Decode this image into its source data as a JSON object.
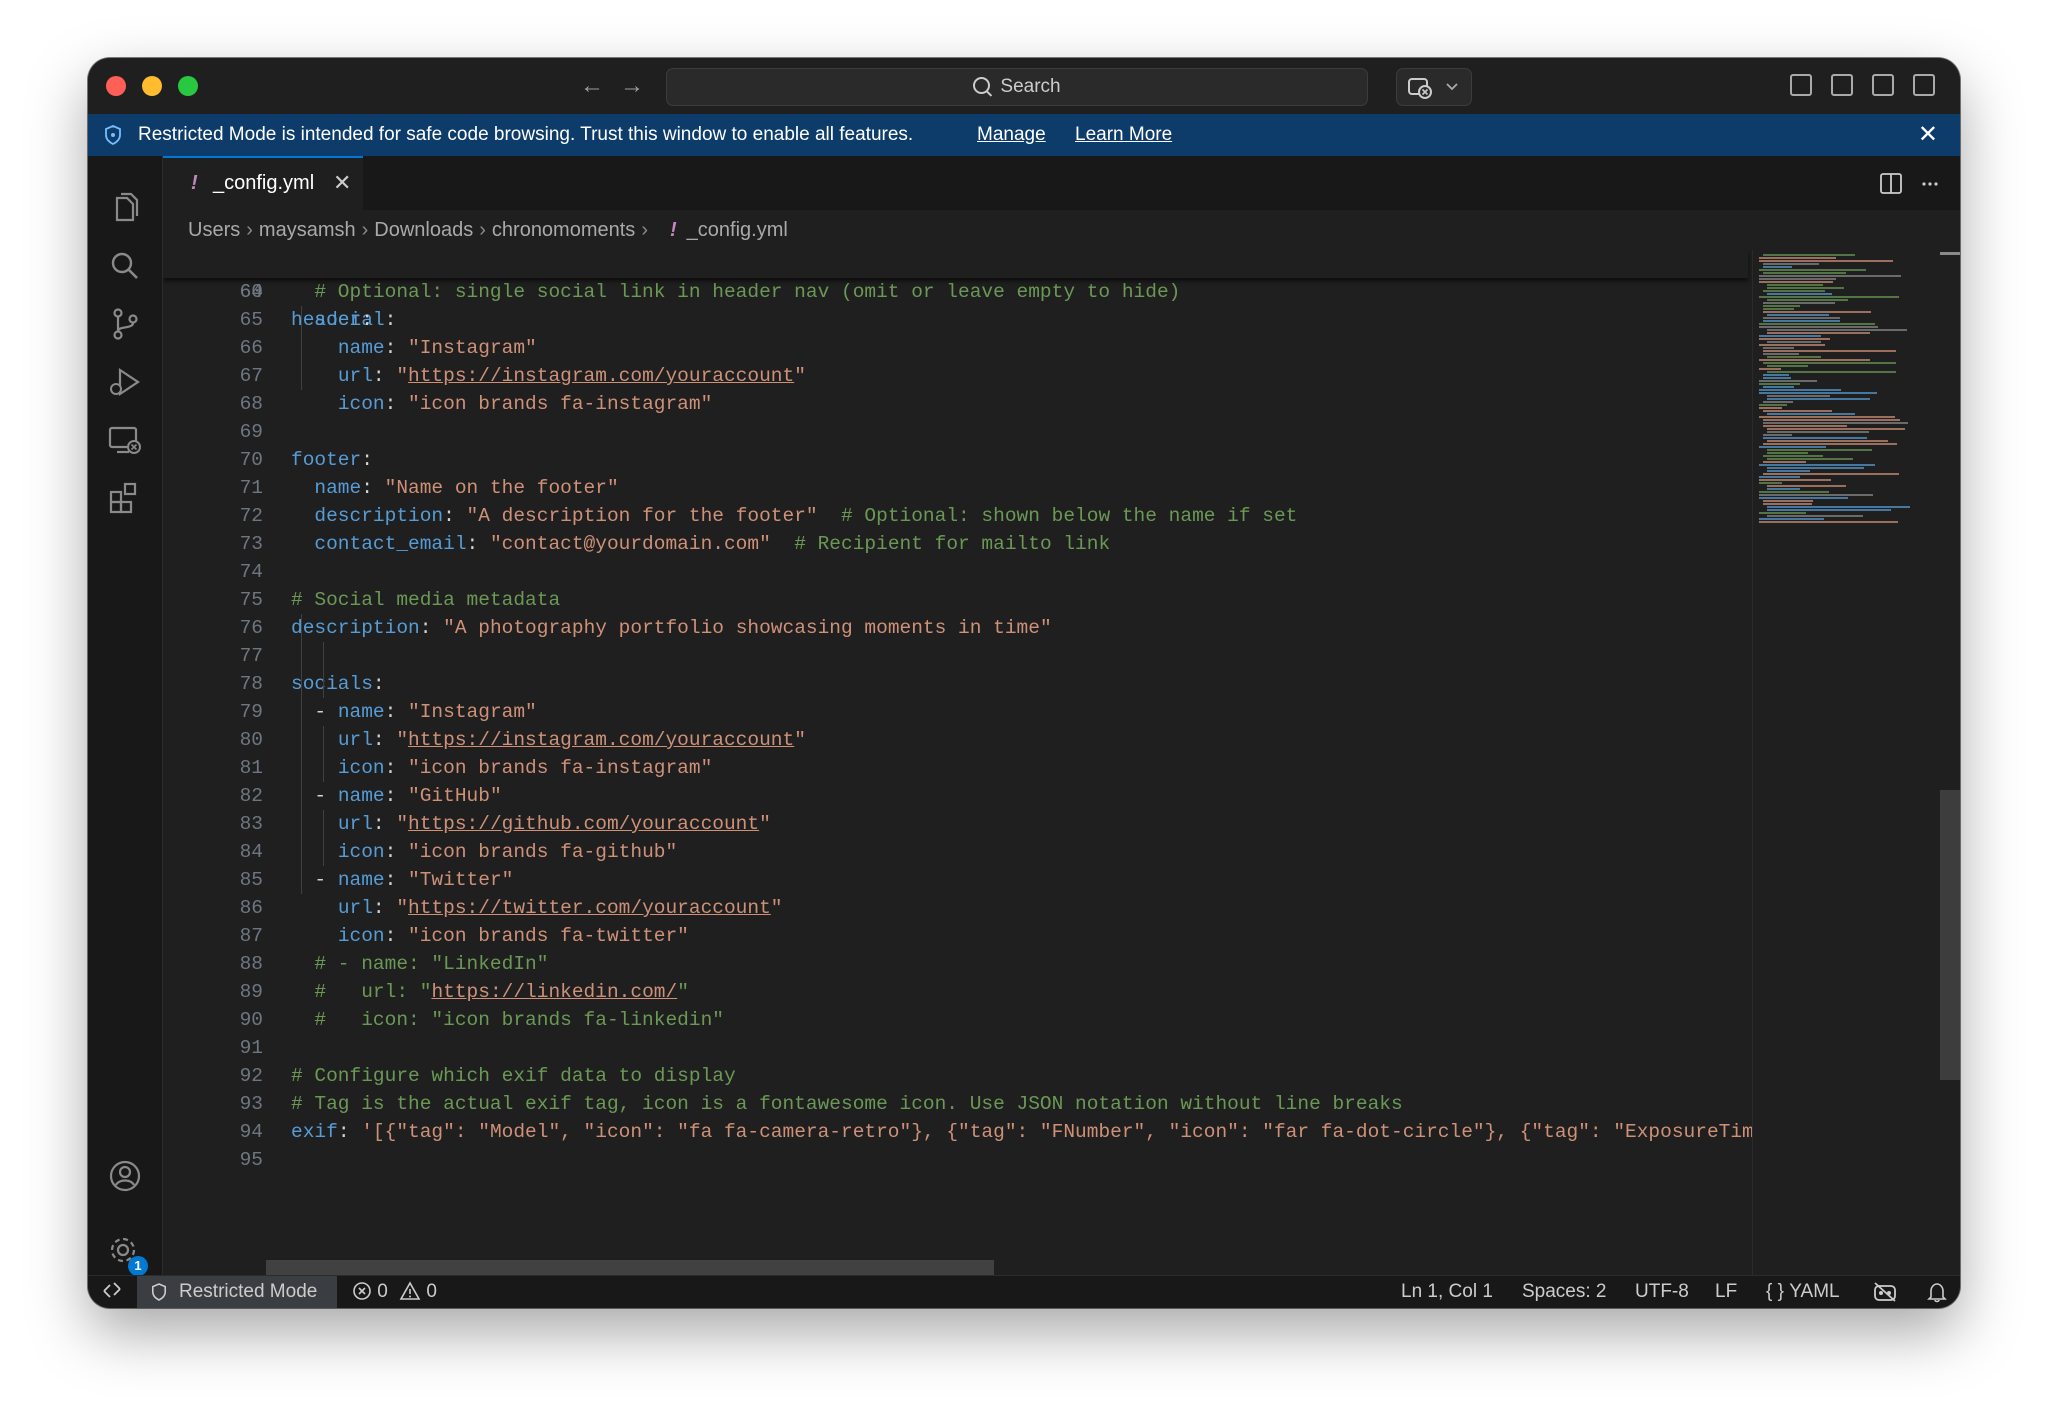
{
  "titlebar": {
    "search_label": "Search"
  },
  "banner": {
    "message": "Restricted Mode is intended for safe code browsing. Trust this window to enable all features.",
    "manage": "Manage",
    "learn_more": "Learn More"
  },
  "tab": {
    "bang": "!",
    "filename": "_config.yml",
    "close": "✕"
  },
  "breadcrumb": [
    "Users",
    "maysamsh",
    "Downloads",
    "chronomoments",
    "_config.yml"
  ],
  "sticky": {
    "ln": "60",
    "key": "header"
  },
  "lines": [
    {
      "ln": "64",
      "comment": "# Optional: single social link in header nav (omit or leave empty to hide)",
      "indent": "  "
    },
    {
      "ln": "65",
      "key": "social",
      "indent": "  "
    },
    {
      "ln": "66",
      "key": "name",
      "value": "\"Instagram\"",
      "indent": "    "
    },
    {
      "ln": "67",
      "key": "url",
      "value_pre": "\"",
      "url": "https://instagram.com/youraccount",
      "value_post": "\"",
      "indent": "    "
    },
    {
      "ln": "68",
      "key": "icon",
      "value": "\"icon brands fa-instagram\"",
      "indent": "    "
    },
    {
      "ln": "69"
    },
    {
      "ln": "70",
      "key": "footer"
    },
    {
      "ln": "71",
      "key": "name",
      "value": "\"Name on the footer\"",
      "indent": "  "
    },
    {
      "ln": "72",
      "key": "description",
      "value": "\"A description for the footer\"",
      "trailing": "  # Optional: shown below the name if set",
      "indent": "  "
    },
    {
      "ln": "73",
      "key": "contact_email",
      "value": "\"contact@yourdomain.com\"",
      "trailing": "  # Recipient for mailto link",
      "indent": "  "
    },
    {
      "ln": "74"
    },
    {
      "ln": "75",
      "comment": "# Social media metadata"
    },
    {
      "ln": "76",
      "key": "description",
      "value": "\"A photography portfolio showcasing moments in time\""
    },
    {
      "ln": "77"
    },
    {
      "ln": "78",
      "key": "socials"
    },
    {
      "ln": "79",
      "dash": "- ",
      "key": "name",
      "value": "\"Instagram\"",
      "indent": "  "
    },
    {
      "ln": "80",
      "key": "url",
      "value_pre": "\"",
      "url": "https://instagram.com/youraccount",
      "value_post": "\"",
      "indent": "    "
    },
    {
      "ln": "81",
      "key": "icon",
      "value": "\"icon brands fa-instagram\"",
      "indent": "    "
    },
    {
      "ln": "82",
      "dash": "- ",
      "key": "name",
      "value": "\"GitHub\"",
      "indent": "  "
    },
    {
      "ln": "83",
      "key": "url",
      "value_pre": "\"",
      "url": "https://github.com/youraccount",
      "value_post": "\"",
      "indent": "    "
    },
    {
      "ln": "84",
      "key": "icon",
      "value": "\"icon brands fa-github\"",
      "indent": "    "
    },
    {
      "ln": "85",
      "dash": "- ",
      "key": "name",
      "value": "\"Twitter\"",
      "indent": "  "
    },
    {
      "ln": "86",
      "key": "url",
      "value_pre": "\"",
      "url": "https://twitter.com/youraccount",
      "value_post": "\"",
      "indent": "    "
    },
    {
      "ln": "87",
      "key": "icon",
      "value": "\"icon brands fa-twitter\"",
      "indent": "    "
    },
    {
      "ln": "88",
      "comment": "# - name: \"LinkedIn\"",
      "indent": "  "
    },
    {
      "ln": "89",
      "comment": "#   url: \"",
      "c_url": "https://linkedin.com/",
      "c_post": "\"",
      "indent": "  "
    },
    {
      "ln": "90",
      "comment": "#   icon: \"icon brands fa-linkedin\"",
      "indent": "  "
    },
    {
      "ln": "91"
    },
    {
      "ln": "92",
      "comment": "# Configure which exif data to display"
    },
    {
      "ln": "93",
      "comment": "# Tag is the actual exif tag, icon is a fontawesome icon. Use JSON notation without line breaks"
    },
    {
      "ln": "94",
      "key": "exif",
      "value": "'[{\"tag\": \"Model\", \"icon\": \"fa fa-camera-retro\"}, {\"tag\": \"FNumber\", \"icon\": \"far fa-dot-circle\"}, {\"tag\": \"ExposureTime\", \"ic"
    },
    {
      "ln": "95"
    }
  ],
  "statusbar": {
    "restricted": "Restricted Mode",
    "errors": "0",
    "warnings": "0",
    "position": "Ln 1, Col 1",
    "spaces": "Spaces: 2",
    "encoding": "UTF-8",
    "eol": "LF",
    "language": "YAML"
  },
  "settings_badge": "1",
  "colors": {
    "accent": "#0078d4",
    "banner": "#0d3c6b",
    "key": "#569cd6",
    "string": "#ce9178",
    "comment": "#6a9955"
  }
}
